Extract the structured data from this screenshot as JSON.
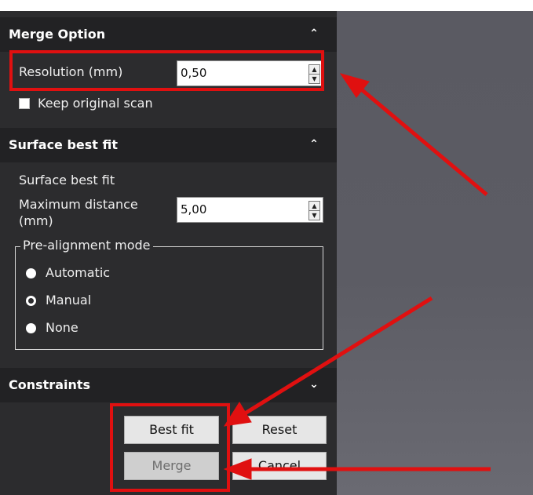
{
  "merge_option": {
    "header": "Merge Option",
    "resolution_label": "Resolution (mm)",
    "resolution_value": "0,50",
    "keep_original_label": "Keep original scan",
    "keep_original_checked": false
  },
  "surface_best_fit": {
    "header": "Surface best fit",
    "subtitle": "Surface best fit",
    "max_distance_label_line1": "Maximum distance",
    "max_distance_label_line2": "(mm)",
    "max_distance_value": "5,00",
    "pre_alignment": {
      "title": "Pre-alignment mode",
      "options": [
        {
          "label": "Automatic",
          "selected": false
        },
        {
          "label": "Manual",
          "selected": true
        },
        {
          "label": "None",
          "selected": false
        }
      ]
    }
  },
  "constraints": {
    "header": "Constraints"
  },
  "buttons": {
    "best_fit": "Best fit",
    "reset": "Reset",
    "merge": "Merge",
    "cancel": "Cancel"
  },
  "icons": {
    "chevron_up": "chevron-up-icon",
    "chevron_down": "chevron-down-icon"
  },
  "colors": {
    "panel_bg": "#2c2c2e",
    "header_bg": "#222224",
    "annotation_red": "#e01010",
    "viewport_gray": "#5c5c64"
  }
}
